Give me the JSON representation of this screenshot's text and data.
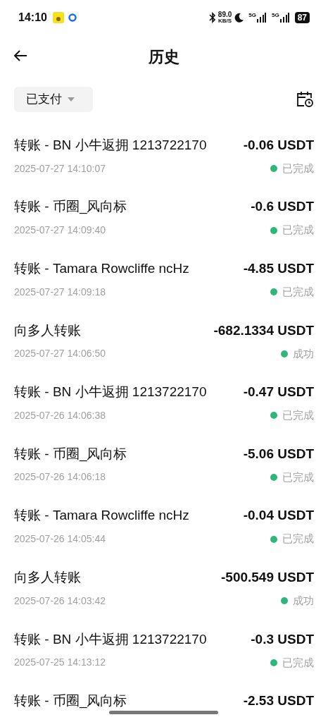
{
  "status_bar": {
    "time": "14:10",
    "speed": "89.0",
    "speed_unit": "KB/S",
    "network_1": "5G",
    "network_2": "5G",
    "battery": "87"
  },
  "header": {
    "title": "历史"
  },
  "filter": {
    "label": "已支付"
  },
  "transactions": [
    {
      "title": "转账 - BN 小牛返拥 1213722170",
      "amount": "-0.06 USDT",
      "time": "2025-07-27 14:10:07",
      "status": "已完成"
    },
    {
      "title": "转账 - 币圈_风向标",
      "amount": "-0.6 USDT",
      "time": "2025-07-27 14:09:40",
      "status": "已完成"
    },
    {
      "title": "转账 - Tamara Rowcliffe ncHz",
      "amount": "-4.85 USDT",
      "time": "2025-07-27 14:09:18",
      "status": "已完成"
    },
    {
      "title": "向多人转账",
      "amount": "-682.1334 USDT",
      "time": "2025-07-27 14:06:50",
      "status": "成功"
    },
    {
      "title": "转账 - BN 小牛返拥 1213722170",
      "amount": "-0.47 USDT",
      "time": "2025-07-26 14:06:38",
      "status": "已完成"
    },
    {
      "title": "转账 - 币圈_风向标",
      "amount": "-5.06 USDT",
      "time": "2025-07-26 14:06:18",
      "status": "已完成"
    },
    {
      "title": "转账 - Tamara Rowcliffe ncHz",
      "amount": "-0.04 USDT",
      "time": "2025-07-26 14:05:44",
      "status": "已完成"
    },
    {
      "title": "向多人转账",
      "amount": "-500.549 USDT",
      "time": "2025-07-26 14:03:42",
      "status": "成功"
    },
    {
      "title": "转账 - BN 小牛返拥 1213722170",
      "amount": "-0.3 USDT",
      "time": "2025-07-25 14:13:12",
      "status": "已完成"
    },
    {
      "title": "转账 - 币圈_风向标",
      "amount": "-2.53 USDT"
    }
  ]
}
